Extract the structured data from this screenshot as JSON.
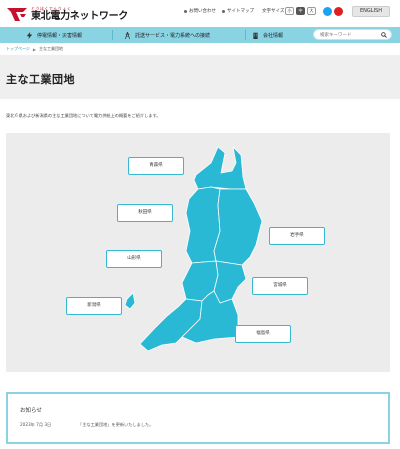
{
  "header": {
    "logo_kana": "とうほくでんりょく",
    "logo_name": "東北電力ネットワーク",
    "util_links": [
      "お問い合わせ",
      "サイトマップ"
    ],
    "font_size_label": "文字サイズ",
    "font_sizes": [
      "小",
      "中",
      "大"
    ],
    "english_label": "ENGLISH"
  },
  "nav": {
    "items": [
      {
        "label": "停電情報・災害情報",
        "icon": "lightning-icon"
      },
      {
        "label": "託送サービス・電力系統への接続",
        "icon": "tower-icon"
      },
      {
        "label": "会社情報",
        "icon": "building-icon"
      }
    ],
    "search_placeholder": "検索キーワード"
  },
  "breadcrumb": {
    "home": "トップページ",
    "current": "主な工業団地"
  },
  "page": {
    "title": "主な工業団地",
    "lead": "東北６県および新潟県の主な工業団地について電力供給上の概要をご紹介します。"
  },
  "map": {
    "prefectures": [
      {
        "id": "aomori",
        "label": "青森県"
      },
      {
        "id": "akita",
        "label": "秋田県"
      },
      {
        "id": "iwate",
        "label": "岩手県"
      },
      {
        "id": "yamagata",
        "label": "山形県"
      },
      {
        "id": "miyagi",
        "label": "宮城県"
      },
      {
        "id": "niigata",
        "label": "新潟県"
      },
      {
        "id": "fukushima",
        "label": "福島県"
      }
    ],
    "colors": {
      "land": "#29b9d4",
      "border": "#ffffff",
      "panel": "#ececec"
    }
  },
  "notice": {
    "title": "お知らせ",
    "date": "2023年 7月 3日",
    "text": "「主な工業団地」を更新いたしました。"
  }
}
